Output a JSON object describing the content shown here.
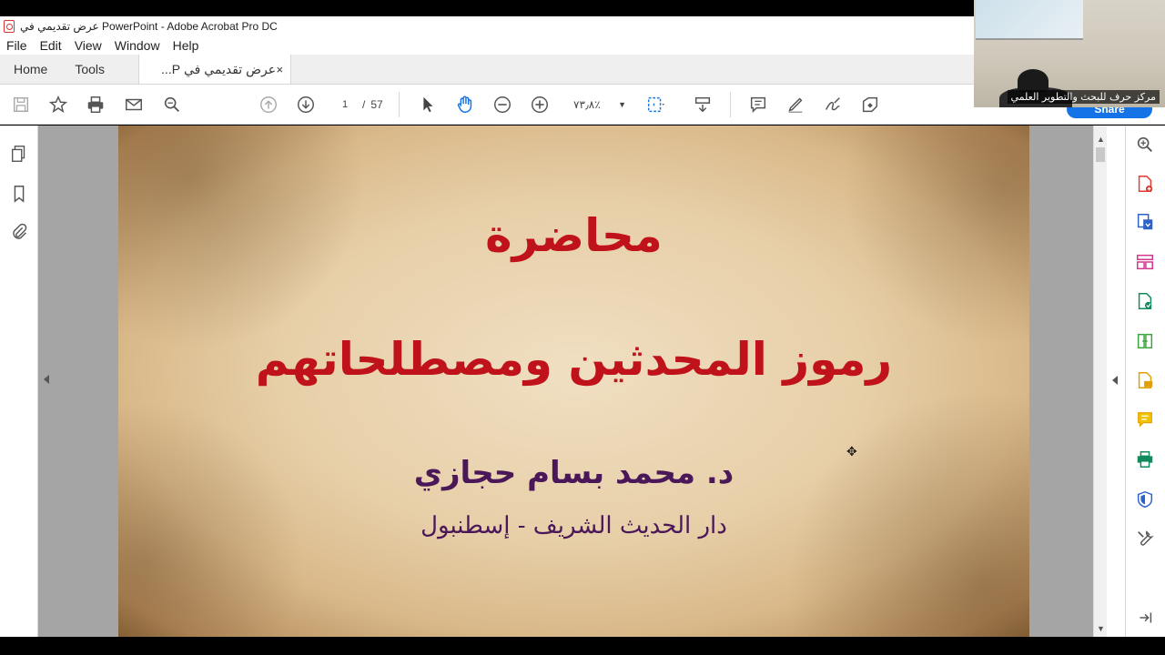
{
  "window": {
    "title": "عرض تقديمي في PowerPoint - Adobe Acrobat Pro DC"
  },
  "menu": [
    "File",
    "Edit",
    "View",
    "Window",
    "Help"
  ],
  "tabs": {
    "home": "Home",
    "tools": "Tools",
    "document": "عرض تقديمي في P...",
    "close": "×"
  },
  "toolbar": {
    "current_page": "1",
    "separator": "/",
    "total_pages": "57",
    "zoom": "٧٣٫٨٪",
    "share": "Share"
  },
  "slide": {
    "title": "محاضرة",
    "subtitle": "رموز المحدثين ومصطلحاتهم",
    "author": "د. محمد بسام حجازي",
    "institution": "دار الحديث الشريف - إسطنبول",
    "title_color": "#c0121b",
    "author_color": "#4a1858"
  },
  "webcam": {
    "label": "مركز حرف للبحث والتطوير العلمي"
  },
  "colors": {
    "accent": "#1473e6",
    "pdf_red": "#d33"
  }
}
